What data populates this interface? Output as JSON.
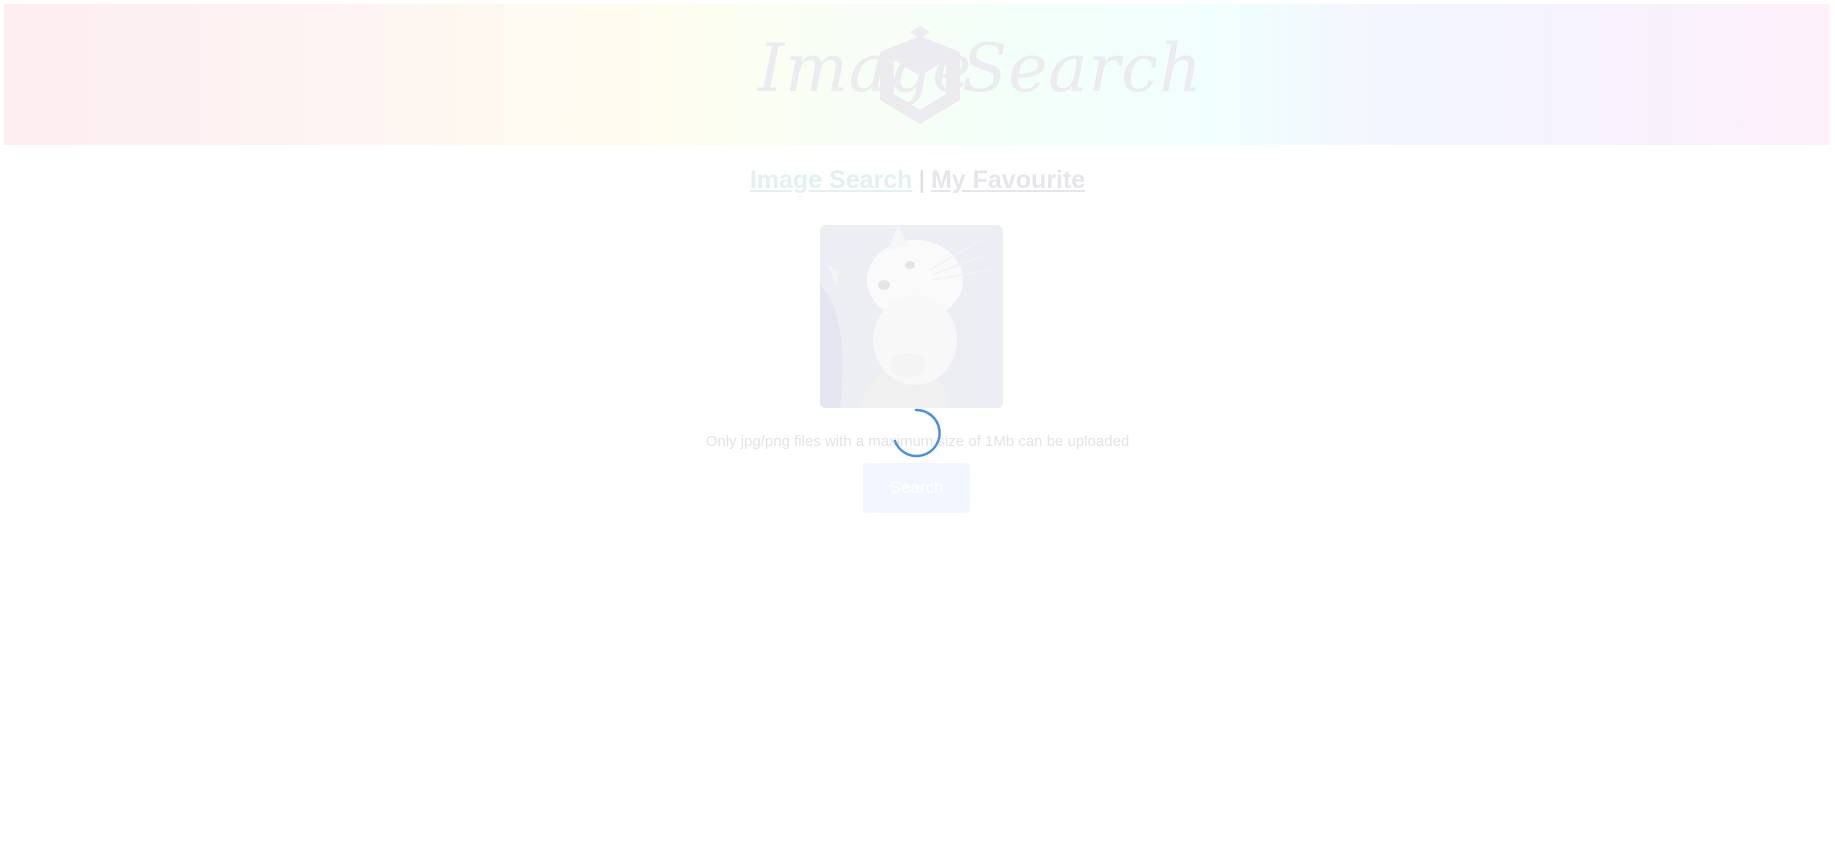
{
  "header": {
    "logo_left": "Image",
    "logo_right": "Search"
  },
  "nav": {
    "image_search": "Image Search",
    "separator": "|",
    "my_favourite": "My Favourite"
  },
  "upload": {
    "preview_icon": "cat-photo",
    "hint": "Only jpg/png files with a maximum size of 1Mb can be uploaded",
    "loading_icon": "loading-spinner-icon"
  },
  "actions": {
    "search_label": "Search"
  },
  "colors": {
    "spinner": "#4a90e2",
    "button_bg": "#f2f6fe"
  }
}
